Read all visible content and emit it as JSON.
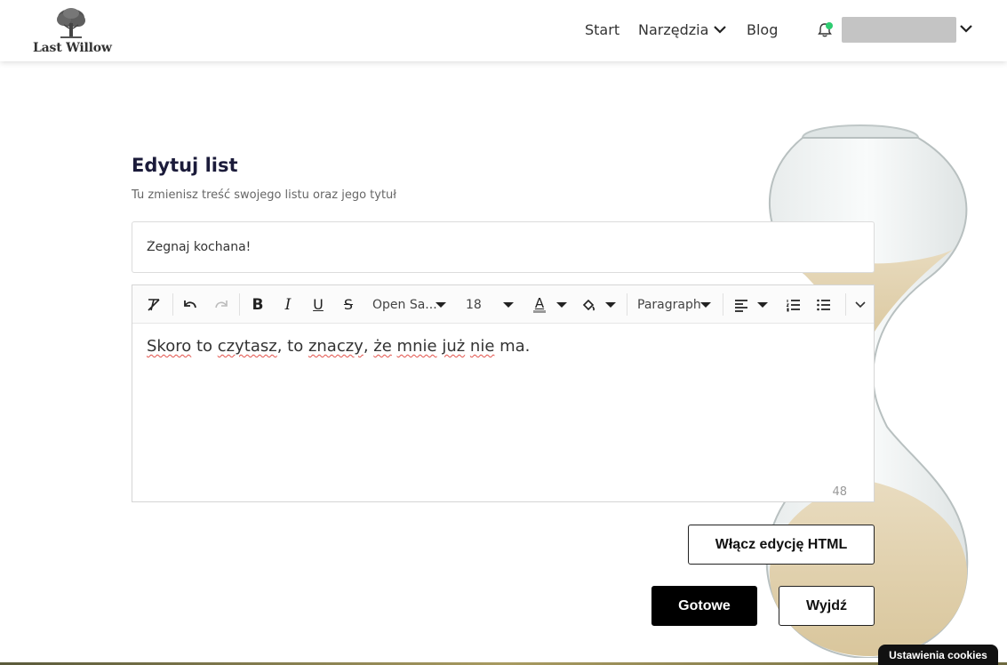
{
  "header": {
    "logo_text": "Last Willow",
    "nav": {
      "start": "Start",
      "tools": "Narzędzia",
      "blog": "Blog"
    },
    "notification_dot_color": "#2ecc71"
  },
  "main": {
    "title": "Edytuj list",
    "subtitle": "Tu zmienisz treść swojego listu oraz jego tytuł",
    "letter_title_value": "Żegnaj kochana!",
    "editor": {
      "toolbar": {
        "font_family": "Open Sa...",
        "font_size": "18",
        "block_format": "Paragraph"
      },
      "content": {
        "w1": "Skoro",
        "s1": " to ",
        "w2": "czytasz",
        "s2": ", to ",
        "w3": "znaczy",
        "s3": ", ",
        "w4": "że",
        "s4": " ",
        "w5": "mnie",
        "s5": " ",
        "w6": "już",
        "s6": " ",
        "w7": "nie",
        "s7": " ma."
      },
      "char_count": "48"
    },
    "buttons": {
      "html_edit": "Włącz edycję HTML",
      "done": "Gotowe",
      "exit": "Wyjdź"
    }
  },
  "cookies_label": "Ustawienia cookies",
  "colors": {
    "primary_button": "#000000",
    "title_text": "#1b1b3a",
    "spellcheck": "#e2524a"
  }
}
